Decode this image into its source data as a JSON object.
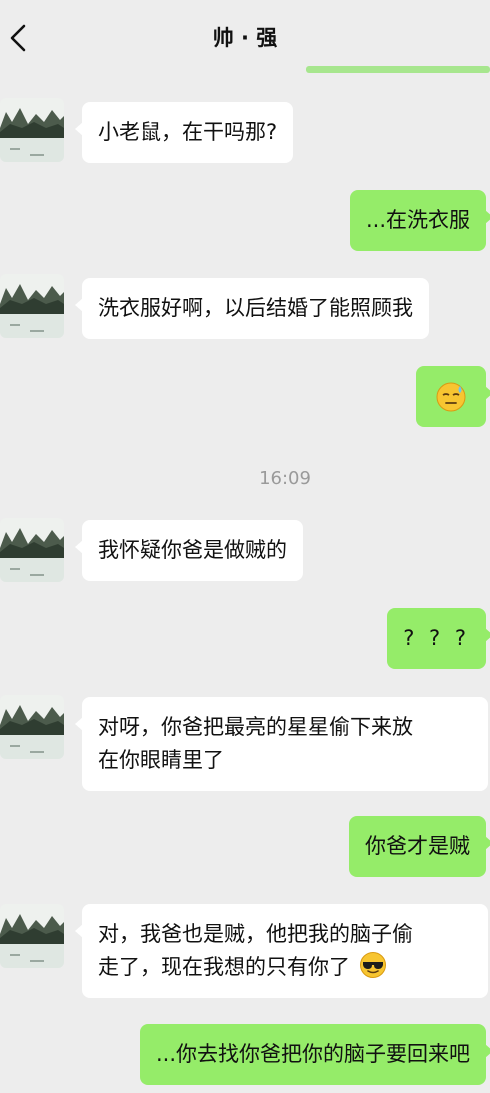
{
  "header": {
    "title": "帅 · 强",
    "accent_color": "#a7e68e"
  },
  "messages": [
    {
      "side": "in",
      "text": "小老鼠，在干吗那?"
    },
    {
      "side": "out",
      "text": "...在洗衣服"
    },
    {
      "side": "in",
      "text": "洗衣服好啊，以后结婚了能照顾我"
    },
    {
      "side": "out",
      "emoji": "relieved-sweat-face-icon",
      "text": ""
    },
    {
      "side": "in",
      "text": "我怀疑你爸是做贼的"
    },
    {
      "side": "out",
      "text": "? ? ?"
    },
    {
      "side": "in",
      "text_line1": "对呀，你爸把最亮的星星偷下来放",
      "text_line2": "在你眼睛里了"
    },
    {
      "side": "out",
      "text": "你爸才是贼"
    },
    {
      "side": "in",
      "text_line1": "对，我爸也是贼，他把我的脑子偷",
      "text_line2": "走了，现在我想的只有你了",
      "emoji": "cool-sunglasses-face-icon"
    },
    {
      "side": "out",
      "text": "...你去找你爸把你的脑子要回来吧"
    }
  ],
  "timestamp": "16:09",
  "colors": {
    "background": "#ededed",
    "incoming_bubble": "#ffffff",
    "outgoing_bubble": "#95ec69"
  }
}
